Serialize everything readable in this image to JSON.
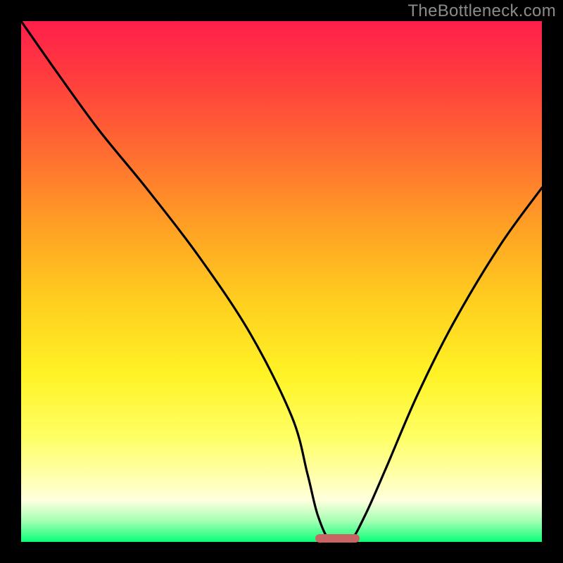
{
  "watermark": "TheBottleneck.com",
  "chart_data": {
    "type": "line",
    "title": "",
    "xlabel": "",
    "ylabel": "",
    "xlim": [
      0,
      100
    ],
    "ylim": [
      0,
      100
    ],
    "series": [
      {
        "name": "bottleneck-curve",
        "x": [
          0,
          7,
          15,
          24,
          34,
          44,
          52,
          55,
          57,
          59.5,
          63,
          66,
          70,
          76,
          83,
          92,
          100
        ],
        "y": [
          100,
          90,
          79,
          68,
          55,
          40,
          24,
          13,
          5,
          0,
          0,
          5,
          14,
          28,
          42,
          57,
          68
        ]
      }
    ],
    "marker": {
      "x_start": 56.5,
      "x_end": 65,
      "color": "#c96464"
    },
    "gradient_stops": [
      {
        "pos": 0,
        "color": "#ff1f4b"
      },
      {
        "pos": 10,
        "color": "#ff3a3f"
      },
      {
        "pos": 26,
        "color": "#ff6f30"
      },
      {
        "pos": 40,
        "color": "#ffa224"
      },
      {
        "pos": 54,
        "color": "#ffcf1f"
      },
      {
        "pos": 68,
        "color": "#fff326"
      },
      {
        "pos": 80,
        "color": "#ffff66"
      },
      {
        "pos": 87,
        "color": "#ffffa8"
      },
      {
        "pos": 92,
        "color": "#ffffde"
      },
      {
        "pos": 96,
        "color": "#a4ffb2"
      },
      {
        "pos": 100,
        "color": "#09ff77"
      }
    ]
  }
}
